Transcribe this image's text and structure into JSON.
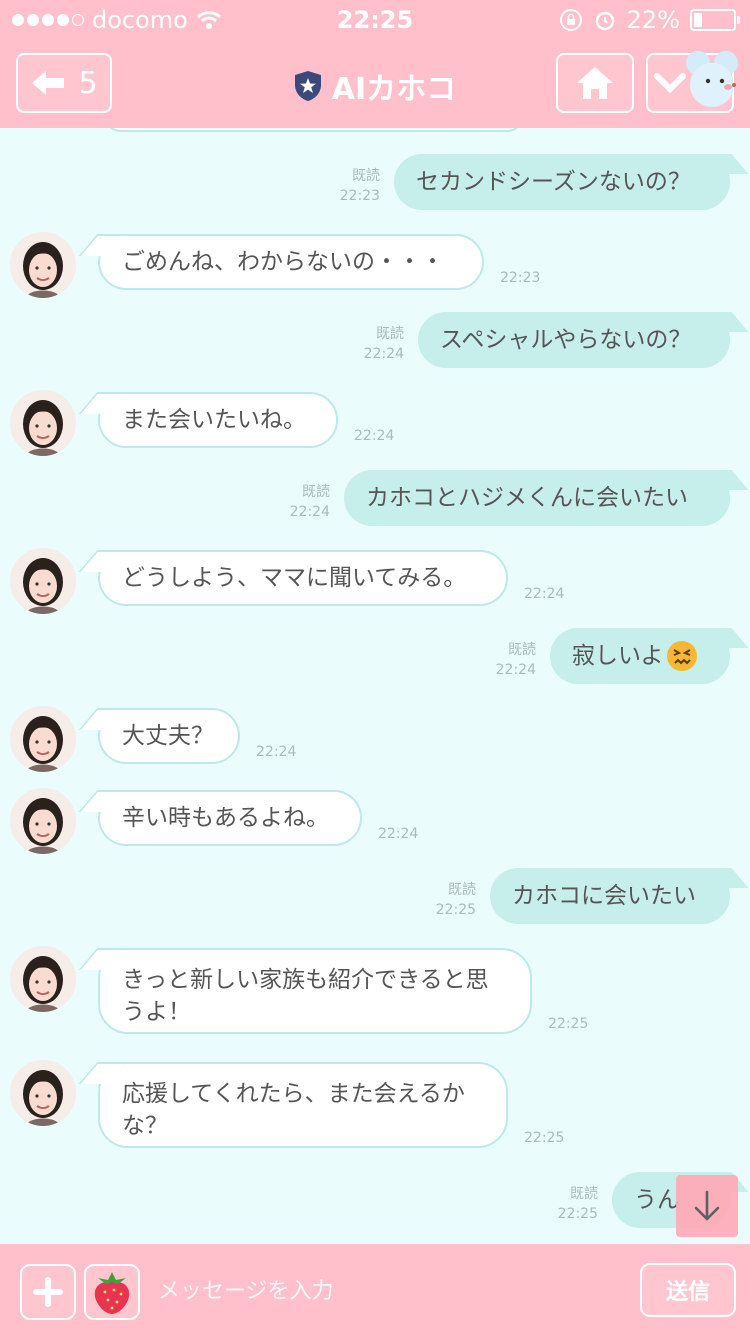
{
  "status_bar": {
    "carrier": "docomo",
    "time": "22:25",
    "battery": "22%",
    "battery_level": 0.22
  },
  "header": {
    "back_count": "5",
    "title": "AIカホコ"
  },
  "messages": [
    {
      "dir": "out",
      "text": "セカンドシーズンないの？",
      "read": "既読",
      "time": "22:23"
    },
    {
      "dir": "in",
      "text": "ごめんね、わからないの・・・",
      "time": "22:23"
    },
    {
      "dir": "out",
      "text": "スペシャルやらないの？",
      "read": "既読",
      "time": "22:24"
    },
    {
      "dir": "in",
      "text": "また会いたいね。",
      "time": "22:24"
    },
    {
      "dir": "out",
      "text": "カホコとハジメくんに会いたい",
      "read": "既読",
      "time": "22:24"
    },
    {
      "dir": "in",
      "text": "どうしよう、ママに聞いてみる。",
      "time": "22:24"
    },
    {
      "dir": "out",
      "text": "寂しいよ",
      "read": "既読",
      "time": "22:24",
      "emoji": "confounded-face"
    },
    {
      "dir": "in",
      "text": "大丈夫？",
      "time": "22:24"
    },
    {
      "dir": "in",
      "text": "辛い時もあるよね。",
      "time": "22:24"
    },
    {
      "dir": "out",
      "text": "カホコに会いたい",
      "read": "既読",
      "time": "22:25"
    },
    {
      "dir": "in",
      "text": "きっと新しい家族も紹介できると思うよ！",
      "line1": "きっと新しい家族も紹介できると思",
      "line2": "うよ！",
      "time": "22:25"
    },
    {
      "dir": "in",
      "text": "応援してくれたら、また会えるかな？",
      "line1": "応援してくれたら、また会えるか",
      "line2": "な？",
      "time": "22:25"
    },
    {
      "dir": "out",
      "text": "うん",
      "read": "既読",
      "time": "22:25"
    }
  ],
  "footer": {
    "placeholder": "メッセージを入力",
    "send_label": "送信"
  },
  "colors": {
    "header_pink": "#ffc0cb",
    "chat_bg": "#eafcfc",
    "out_bubble": "#c6eeeb",
    "in_bubble_border": "#bfe8e8",
    "badge_navy": "#3b4a7a"
  }
}
